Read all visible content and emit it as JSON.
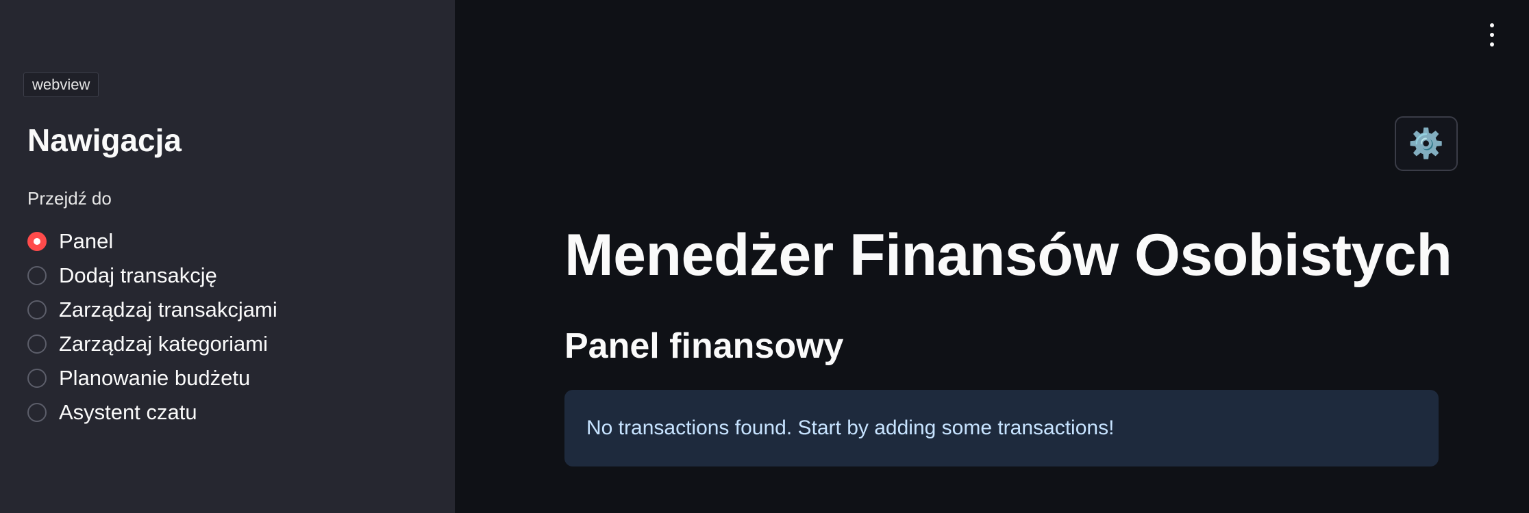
{
  "sidebar": {
    "webview_tag": "webview",
    "title": "Nawigacja",
    "radio_label": "Przejdź do",
    "items": [
      {
        "label": "Panel",
        "selected": true
      },
      {
        "label": "Dodaj transakcję",
        "selected": false
      },
      {
        "label": "Zarządzaj transakcjami",
        "selected": false
      },
      {
        "label": "Zarządzaj kategoriami",
        "selected": false
      },
      {
        "label": "Planowanie budżetu",
        "selected": false
      },
      {
        "label": "Asystent czatu",
        "selected": false
      }
    ]
  },
  "header": {
    "menu_icon": "kebab-menu-icon",
    "settings_icon": "gear-icon",
    "settings_glyph": "⚙️"
  },
  "main": {
    "title": "Menedżer Finansów Osobistych",
    "section_title": "Panel finansowy",
    "info_message": "No transactions found. Start by adding some transactions!"
  },
  "colors": {
    "accent": "#ff4b4b",
    "sidebar_bg": "#262730",
    "main_bg": "#0f1116",
    "info_bg": "#1e2a3d",
    "info_text": "#c7e3ff"
  }
}
